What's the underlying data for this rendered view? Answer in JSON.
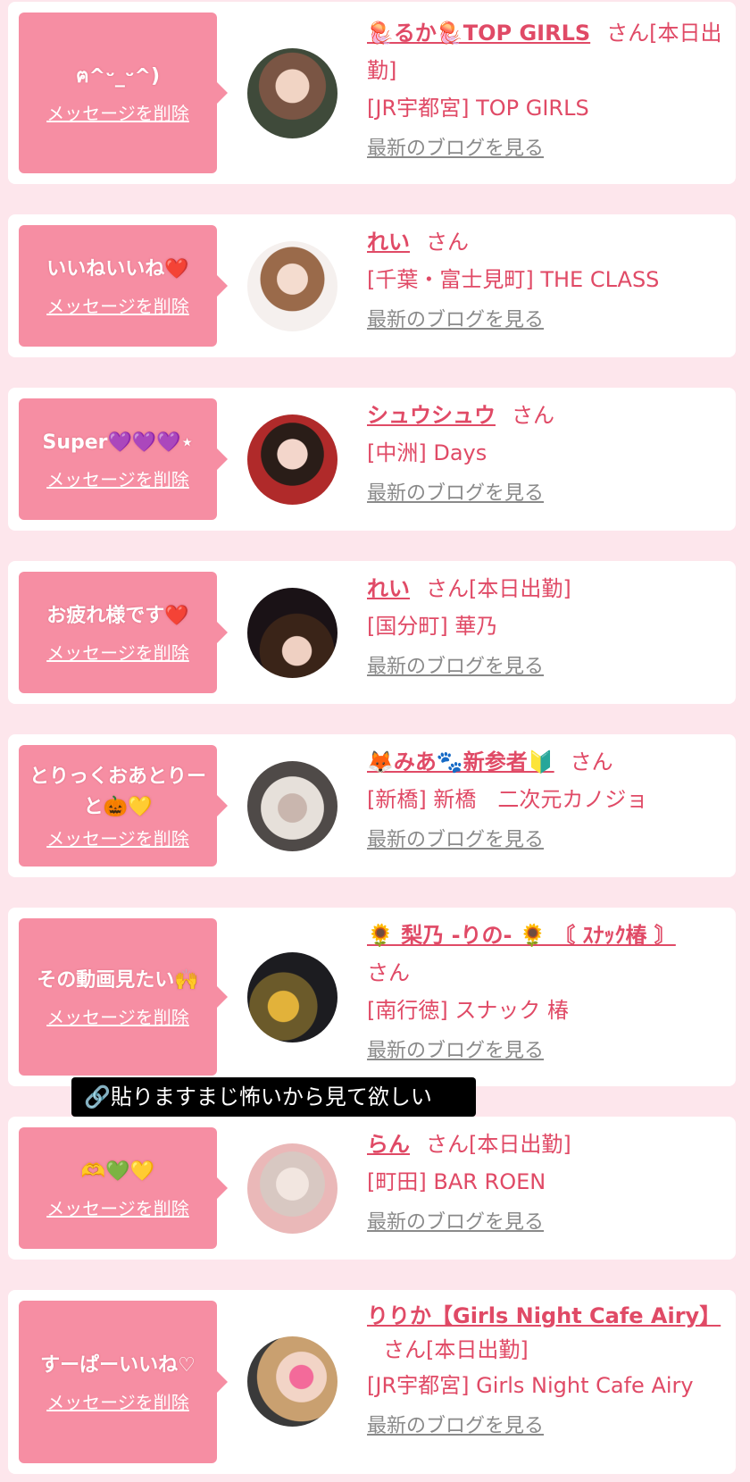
{
  "entries": [
    {
      "message": "ฅ^ᵕ_ᵕ^)",
      "delete_label": "メッセージを削除",
      "name": "🪼るか🪼TOP GIRLS",
      "suffix": "さん[本日出勤]",
      "shop": "[JR宇都宮] TOP GIRLS",
      "blog_link": "最新のブログを見る"
    },
    {
      "message": "いいねいいね❤️",
      "delete_label": "メッセージを削除",
      "name": "れい",
      "suffix": "さん",
      "shop": "[千葉・富士見町] THE CLASS",
      "blog_link": "最新のブログを見る"
    },
    {
      "message": "Super💜💜💜⋆",
      "delete_label": "メッセージを削除",
      "name": "シュウシュウ",
      "suffix": "さん",
      "shop": "[中洲] Days",
      "blog_link": "最新のブログを見る"
    },
    {
      "message": "お疲れ様です❤️",
      "delete_label": "メッセージを削除",
      "name": "れい",
      "suffix": "さん[本日出勤]",
      "shop": "[国分町] 華乃",
      "blog_link": "最新のブログを見る"
    },
    {
      "message": "とりっくおあとりーと🎃💛",
      "delete_label": "メッセージを削除",
      "name": "🦊みあ🐾新参者🔰",
      "suffix": "さん",
      "shop": "[新橋] 新橋　二次元カノジョ",
      "blog_link": "最新のブログを見る"
    },
    {
      "message": "その動画見たい🙌",
      "delete_label": "メッセージを削除",
      "name": "🌻 梨乃 -りの- 🌻 〘 ｽﾅｯｸ椿 〙",
      "suffix": "さん",
      "shop": "[南行徳] スナック 椿",
      "blog_link": "最新のブログを見る"
    },
    {
      "message": "🫶💚💛",
      "delete_label": "メッセージを削除",
      "name": "らん",
      "suffix": "さん[本日出勤]",
      "shop": "[町田] BAR ROEN",
      "blog_link": "最新のブログを見る"
    },
    {
      "message": "すーぱーいいね♡",
      "delete_label": "メッセージを削除",
      "name": "りりか【Girls Night Cafe Airy】",
      "suffix": "さん[本日出勤]",
      "shop": "[JR宇都宮] Girls Night Cafe Airy",
      "blog_link": "最新のブログを見る"
    }
  ],
  "tooltip": "🔗貼りますまじ怖いから見て欲しい",
  "colors": {
    "background": "#fde6ec",
    "bubble": "#f68ea3",
    "name_pink": "#e04a66",
    "link_gray": "#8a8a8a"
  }
}
